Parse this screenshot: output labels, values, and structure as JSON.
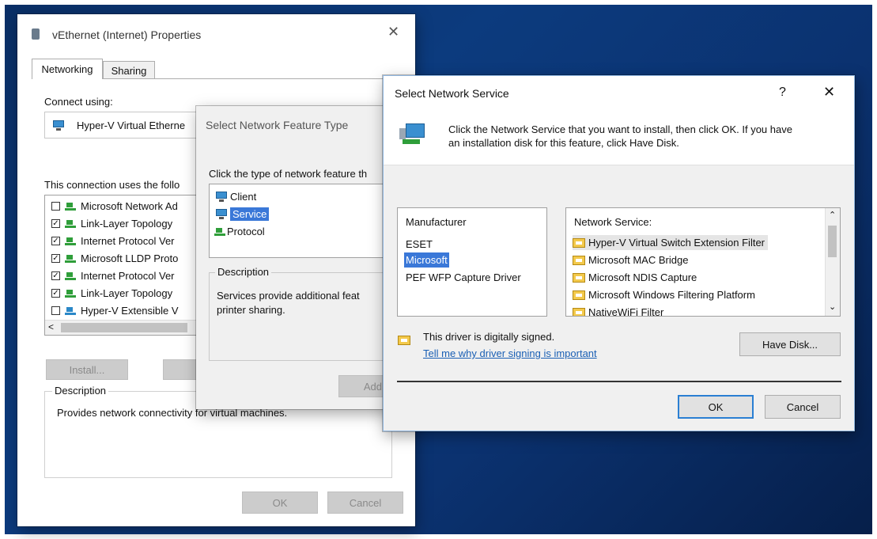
{
  "props": {
    "title": "vEthernet (Internet) Properties",
    "tabs": [
      "Networking",
      "Sharing"
    ],
    "connect_using_label": "Connect using:",
    "adapter": "Hyper-V Virtual Etherne",
    "uses_label": "This connection uses the follo",
    "items": [
      {
        "checked": false,
        "label": "Microsoft Network Ad"
      },
      {
        "checked": true,
        "label": "Link-Layer Topology"
      },
      {
        "checked": true,
        "label": "Internet Protocol Ver"
      },
      {
        "checked": true,
        "label": "Microsoft LLDP Proto"
      },
      {
        "checked": true,
        "label": "Internet Protocol Ver"
      },
      {
        "checked": true,
        "label": "Link-Layer Topology"
      },
      {
        "checked": false,
        "label": "Hyper-V Extensible V"
      }
    ],
    "install_label": "Install...",
    "description_legend": "Description",
    "description_text": "Provides network connectivity for virtual machines.",
    "ok_label": "OK",
    "cancel_label": "Cancel"
  },
  "feature": {
    "title": "Select Network Feature Type",
    "prompt": "Click the type of network feature th",
    "types": [
      "Client",
      "Service",
      "Protocol"
    ],
    "selected_type": "Service",
    "description_legend": "Description",
    "description_text": "Services provide additional feat printer sharing.",
    "description_line1": "Services provide additional feat",
    "description_line2": "printer sharing.",
    "add_label": "Add"
  },
  "service": {
    "title": "Select Network Service",
    "help_glyph": "?",
    "close_glyph": "✕",
    "instruction_line1": "Click the Network Service that you want to install, then click OK. If you have",
    "instruction_line2": "an installation disk for this feature, click Have Disk.",
    "manufacturer_header": "Manufacturer",
    "manufacturers": [
      "ESET",
      "Microsoft",
      "PEF WFP Capture Driver"
    ],
    "selected_manufacturer": "Microsoft",
    "service_header": "Network Service:",
    "services": [
      "Hyper-V Virtual Switch Extension Filter",
      "Microsoft MAC Bridge",
      "Microsoft NDIS Capture",
      "Microsoft Windows Filtering Platform",
      "NativeWiFi Filter"
    ],
    "signed_text": "This driver is digitally signed.",
    "signing_link": "Tell me why driver signing is important",
    "have_disk_label": "Have Disk...",
    "ok_label": "OK",
    "cancel_label": "Cancel"
  }
}
